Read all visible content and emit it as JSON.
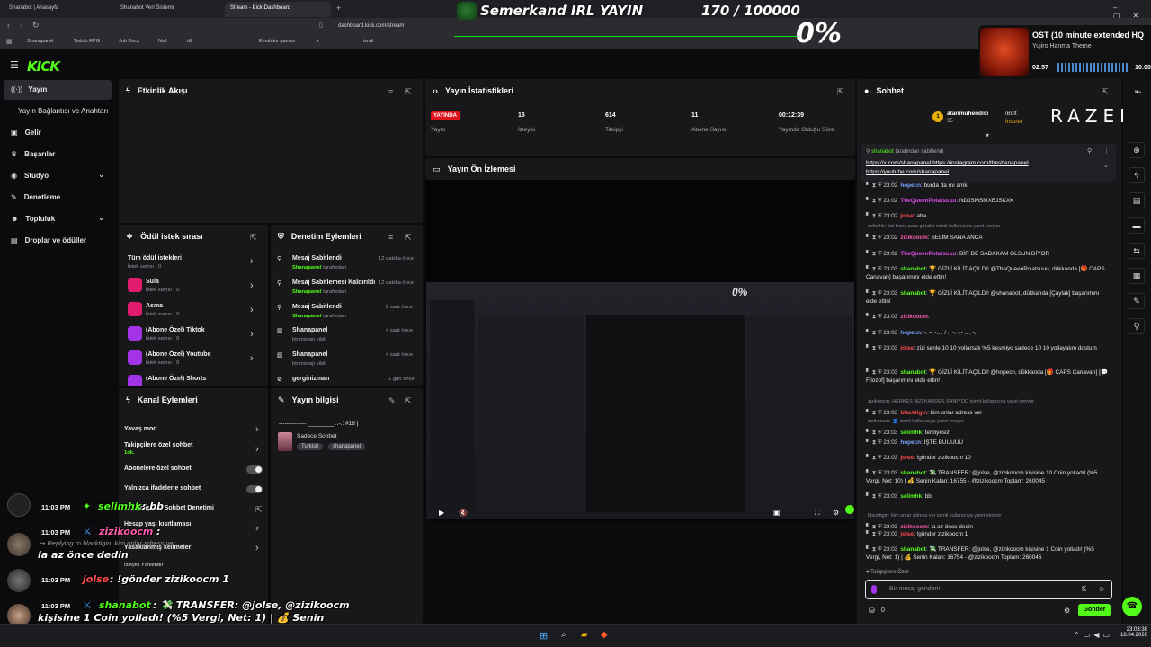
{
  "browser": {
    "tabs": [
      "Shanabot | Anasayfa",
      "Shanabot Veri Sistemi",
      "Stream - Kick Dashboard"
    ],
    "url": "dashboard.kick.com/stream",
    "bookmarks": [
      "Shanapanel",
      "Twitch RPG",
      "Job Docs",
      "Null",
      "dil",
      "",
      "",
      "Emulator games",
      "x",
      "",
      "israil"
    ]
  },
  "overlay_top": {
    "title": "Semerkand IRL YAYIN",
    "goal": "170 / 100000",
    "percent": "0%"
  },
  "music": {
    "title": "OST (10 minute extended HQ",
    "artist": "Yujiro Hanma Theme",
    "time_current": "02:57",
    "time_end": "10:00"
  },
  "logo": "KICK",
  "sidebar": {
    "items": [
      {
        "label": "Yayın",
        "icon": "broadcast-icon"
      },
      {
        "label": "Yayın Bağlantısı ve Anahtarı",
        "icon": ""
      },
      {
        "label": "Gelir",
        "icon": "money-icon"
      },
      {
        "label": "Başarılar",
        "icon": "trophy-icon"
      },
      {
        "label": "Stüdyo",
        "icon": "studio-icon"
      },
      {
        "label": "Denetleme",
        "icon": "wrench-icon"
      },
      {
        "label": "Topluluk",
        "icon": "users-icon"
      },
      {
        "label": "Droplar ve ödüller",
        "icon": "gift-icon"
      }
    ]
  },
  "activity_feed": {
    "title": "Etkinlik Akışı"
  },
  "rewards": {
    "title": "Ödül istek sırası",
    "items": [
      {
        "name": "Tüm ödül istekleri",
        "sub": "İstek sayısı · 0"
      },
      {
        "name": "Sula",
        "sub": "İstek sayısı · 0"
      },
      {
        "name": "Asma",
        "sub": "İstek sayısı · 0"
      },
      {
        "name": "(Abone Özel) Tiktok",
        "sub": "İstek sayısı · 0"
      },
      {
        "name": "(Abone Özel) Youtube",
        "sub": "İstek sayısı · 0"
      },
      {
        "name": "(Abone Özel) Shorts",
        "sub": ""
      }
    ]
  },
  "mod_actions": {
    "title": "Denetim Eylemleri",
    "items": [
      {
        "action": "Mesaj Sabitlendi",
        "by": "Shanapanel",
        "by_suffix": "tarafından",
        "time": "12 dakika önce"
      },
      {
        "action": "Mesaj Sabitlemesi Kaldırıldı",
        "by": "Shanapanel",
        "by_suffix": "tarafından",
        "time": "12 dakika önce"
      },
      {
        "action": "Mesaj Sabitlendi",
        "by": "Shanapanel",
        "by_suffix": "tarafından",
        "time": "2 saat önce"
      },
      {
        "action": "Shanapanel",
        "by": "",
        "by_suffix": "bir mesajı sildi",
        "time": "4 saat önce"
      },
      {
        "action": "Shanapanel",
        "by": "",
        "by_suffix": "bir mesajı sildi",
        "time": "4 saat önce"
      },
      {
        "action": "gerginizman",
        "by": "",
        "by_suffix": "",
        "time": "1 gün önce"
      }
    ]
  },
  "channel_actions": {
    "title": "Kanal Eylemleri",
    "items": [
      {
        "label": "Yavaş mod",
        "sub": "",
        "control": "chevron"
      },
      {
        "label": "Takipçilere özel sohbet",
        "sub": "1dk.",
        "control": "chevron"
      },
      {
        "label": "Abonelere özel sohbet",
        "sub": "",
        "control": "toggle"
      },
      {
        "label": "Yalnızca ifadelerle sohbet",
        "sub": "",
        "control": "toggle"
      },
      {
        "label": "Gelişmiş Bot Sohbet Denetimi",
        "sub": "",
        "control": "external"
      },
      {
        "label": "Hesap yaşı kısıtlaması",
        "sub": "",
        "control": "chevron"
      },
      {
        "label": "Yasaklanmış kelimeler",
        "sub": "",
        "control": "chevron"
      },
      {
        "label": "İzleyici Yönlendir",
        "sub": "",
        "control": ""
      }
    ]
  },
  "stream_info": {
    "title": "Yayın bilgisi",
    "stream_title": "-------------- ________ ..-.: #18 |",
    "category": "Sadece Sohbet",
    "tags": [
      "Turkish",
      "shanapanel"
    ]
  },
  "stats": {
    "title": "Yayın İstatistikleri",
    "items": [
      {
        "value": "YAYINDA",
        "label": "Yayın"
      },
      {
        "value": "16",
        "label": "İzleyici"
      },
      {
        "value": "614",
        "label": "Takipçi"
      },
      {
        "value": "11",
        "label": "Abone Sayısı"
      },
      {
        "value": "00:12:39",
        "label": "Yayında Olduğu Süre"
      }
    ]
  },
  "preview": {
    "title": "Yayın Ön İzlemesi"
  },
  "chat": {
    "title": "Sohbet",
    "top_user": {
      "rank": "1",
      "name": "atarimuhendisi",
      "count": "35"
    },
    "second_user": {
      "name": "iBolt",
      "badge": "İnsurer"
    },
    "sponsor": "RAZER",
    "pinned": {
      "by": "shanabot",
      "suffix": "tarafından sabitlendi",
      "links": [
        "https://x.com/shanapanel",
        "https://instagram.com/theshanapanel",
        "https://youtube.com/shanapanel"
      ]
    },
    "messages": [
      {
        "time": "23:02",
        "user": "hopecn",
        "color": "#7aa7ff",
        "text": "burda da mı amk",
        "reply": ""
      },
      {
        "time": "23:02",
        "user": "TheQueenPolatsuuu",
        "color": "#d64ce0",
        "text": "NDJSMSMXEJSKXK",
        "reply": ""
      },
      {
        "time": "23:02",
        "user": "jolse",
        "color": "#ff4b4b",
        "text": "aha",
        "reply": ""
      },
      {
        "time": "23:02",
        "user": "zizikoocm",
        "color": "#ff5cae",
        "text": "SELİM SANA ANCA",
        "reply": "selimhk: zizi bana para gönder isimli kullanıcıya yanıt veriyor"
      },
      {
        "time": "23:02",
        "user": "TheQueenPolatsuuu",
        "color": "#d64ce0",
        "text": "BİR DE SADAKAM OLSUN DİYOR",
        "reply": ""
      },
      {
        "time": "23:03",
        "user": "shanabot",
        "color": "#53fc18",
        "text": "🏆 GİZLİ KİLİT AÇILDI! @TheQueenPolatsuuu, dükkanda [🎁 CAPS Canavarı] başarımını elde ettin!",
        "reply": ""
      },
      {
        "time": "23:03",
        "user": "shanabot",
        "color": "#53fc18",
        "text": "🏆 GİZLİ KİLİT AÇILDI! @shanabot, dükkanda [Çaylak] başarımını elde ettin!",
        "reply": ""
      },
      {
        "time": "23:03",
        "user": "zizikoocm",
        "color": "#ff5cae",
        "text": "",
        "reply": ""
      },
      {
        "time": "23:03",
        "user": "hopecn",
        "color": "#7aa7ff",
        "text": "-. -- -.. . / .. -. -.- .. . -..",
        "reply": ""
      },
      {
        "time": "23:03",
        "user": "jolse",
        "color": "#ff4b4b",
        "text": "zizi senle 10 10 yollarsak %5 kesmiyo sadece 10 10 yollayalım dostum",
        "reply": ""
      },
      {
        "time": "23:03",
        "user": "shanabot",
        "color": "#53fc18",
        "text": "🏆 GİZLİ KİLİT AÇILDI! @hopecn, dükkanda [🎁 CAPS Canavarı] [💬 Filozof] başarımını elde ettin!",
        "reply": ""
      },
      {
        "time": "23:03",
        "user": "blacktigin",
        "color": "#ff4b4b",
        "text": "kim onlar adress ver",
        "reply": "zizikoocm: HERKES BİZİ KARDEŞ SANIYOO isimli kullanıcıya yanıt veriyor"
      },
      {
        "time": "23:03",
        "user": "selimhk",
        "color": "#53fc18",
        "text": "terbiyesiz",
        "reply": "zizikoocm: 👤 isimli kullanıcıya yanıt veriyor"
      },
      {
        "time": "23:03",
        "user": "hopecn",
        "color": "#7aa7ff",
        "text": "İŞTE BUUUUU",
        "reply": ""
      },
      {
        "time": "23:03",
        "user": "jolse",
        "color": "#ff4b4b",
        "text": "!gönder zizikoocm 10",
        "reply": ""
      },
      {
        "time": "23:03",
        "user": "shanabot",
        "color": "#53fc18",
        "text": "💸 TRANSFER: @jolse, @zizikoocm kişisine 10 Coin yolladı! (%5 Vergi, Net: 10) | 💰 Senin Kalan: 16755 - @zizikoocm Toplam: 260045",
        "reply": ""
      },
      {
        "time": "23:03",
        "user": "selimhk",
        "color": "#53fc18",
        "text": "bb",
        "reply": ""
      },
      {
        "time": "23:03",
        "user": "zizikoocm",
        "color": "#ff5cae",
        "text": "la az önce dedin",
        "reply": "blacktigin: kim onlar adress ver isimli kullanıcıya yanıt veriyor"
      },
      {
        "time": "23:03",
        "user": "jolse",
        "color": "#ff4b4b",
        "text": "!gönder zizikoocm 1",
        "reply": ""
      },
      {
        "time": "23:03",
        "user": "shanabot",
        "color": "#53fc18",
        "text": "💸 TRANSFER: @jolse, @zizikoocm kişisine 1 Coin yolladı! (%5 Vergi, Net: 1) | 💰 Senin Kalan: 16754 - @zizikoocm Toplam: 260046",
        "reply": ""
      }
    ],
    "followers_only": "Takipçilere Özel",
    "input_placeholder": "Bir mesaj gönderin",
    "points": "0",
    "send_label": "Gönder"
  },
  "overlay_chat": [
    {
      "time": "11:03 PM",
      "user": "selimhk",
      "text": ": bb",
      "reply": "",
      "continuation": "",
      "color": "#53fc18"
    },
    {
      "time": "11:03 PM",
      "user": "zizikoocm",
      "text": ":",
      "reply": "Replying to blacktigin: kim onlar adress ver",
      "continuation": "la az önce dedin",
      "color": "#ff5cae"
    },
    {
      "time": "11:03 PM",
      "user": "jolse",
      "text": ": !gönder zizikoocm 1",
      "reply": "",
      "continuation": "",
      "color": "#ff4b4b"
    },
    {
      "time": "11:03 PM",
      "user": "shanabot",
      "text": ": 💸 TRANSFER: @jolse, @zizikoocm",
      "reply": "",
      "continuation": "kişisine 1 Coin yolladı! (%5 Vergi, Net: 1) | 💰 Senin Kalan: 16754 - @zizikoocm Toplam: 260046",
      "color": "#53fc18"
    }
  ],
  "taskbar": {
    "time": "23:03:38",
    "date": "18.04.2026"
  }
}
